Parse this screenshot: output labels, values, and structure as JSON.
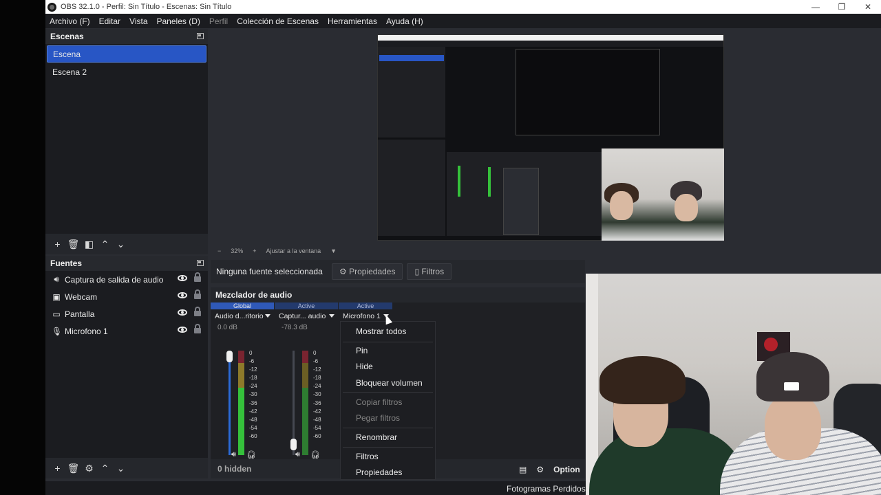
{
  "window": {
    "title": "OBS 32.1.0 - Perfil: Sin Título - Escenas: Sin Título",
    "controls": [
      "—",
      "❐",
      "✕"
    ]
  },
  "menu": [
    "Archivo (F)",
    "Editar",
    "Vista",
    "Paneles (D)",
    "Perfil",
    "Colección de Escenas",
    "Herramientas",
    "Ayuda (H)"
  ],
  "scenes": {
    "title": "Escenas",
    "items": [
      "Escena",
      "Escena 2"
    ],
    "selected": "Escena"
  },
  "sources": {
    "title": "Fuentes",
    "items": [
      {
        "label": "Captura de salida de audio",
        "icon": "speaker-icon"
      },
      {
        "label": "Webcam",
        "icon": "camera-icon"
      },
      {
        "label": "Pantalla",
        "icon": "monitor-icon"
      },
      {
        "label": "Microfono 1",
        "icon": "microphone-icon"
      }
    ]
  },
  "preview_toolbar": {
    "zoom_out": "−",
    "zoom": "32%",
    "zoom_in": "+",
    "fit": "Ajustar a la ventana"
  },
  "context_bar": {
    "no_selection": "Ninguna fuente seleccionada",
    "properties": "Propiedades",
    "filters": "Filtros"
  },
  "mixer": {
    "title": "Mezclador de audio",
    "hidden": "0 hidden",
    "channels": [
      {
        "badge": "Global",
        "name": "Audio d...ritorio",
        "db": "0.0 dB"
      },
      {
        "badge": "Active",
        "name": "Captur... audio",
        "db": "-78.3 dB"
      },
      {
        "badge": "Active",
        "name": "Microfono 1",
        "db": ""
      }
    ],
    "ticks": [
      "0",
      "-6",
      "-12",
      "-18",
      "-24",
      "-30",
      "-36",
      "-42",
      "-48",
      "-54",
      "-60"
    ]
  },
  "context_menu": {
    "items": [
      {
        "label": "Mostrar todos",
        "enabled": true
      },
      {
        "label": "Pin",
        "enabled": true
      },
      {
        "label": "Hide",
        "enabled": true
      },
      {
        "label": "Bloquear volumen",
        "enabled": true
      },
      {
        "label": "Copiar filtros",
        "enabled": false
      },
      {
        "label": "Pegar filtros",
        "enabled": false
      },
      {
        "label": "Renombrar",
        "enabled": true
      },
      {
        "label": "Filtros",
        "enabled": true
      },
      {
        "label": "Propiedades",
        "enabled": true
      }
    ]
  },
  "controls": {
    "options_label": "Option"
  },
  "status": {
    "dropped_frames": "Fotogramas Perdidos ("
  },
  "colors": {
    "accent": "#2856c5",
    "meter_green": "#35c13b",
    "meter_yellow": "#c9b23a",
    "meter_red": "#c63b3b"
  }
}
